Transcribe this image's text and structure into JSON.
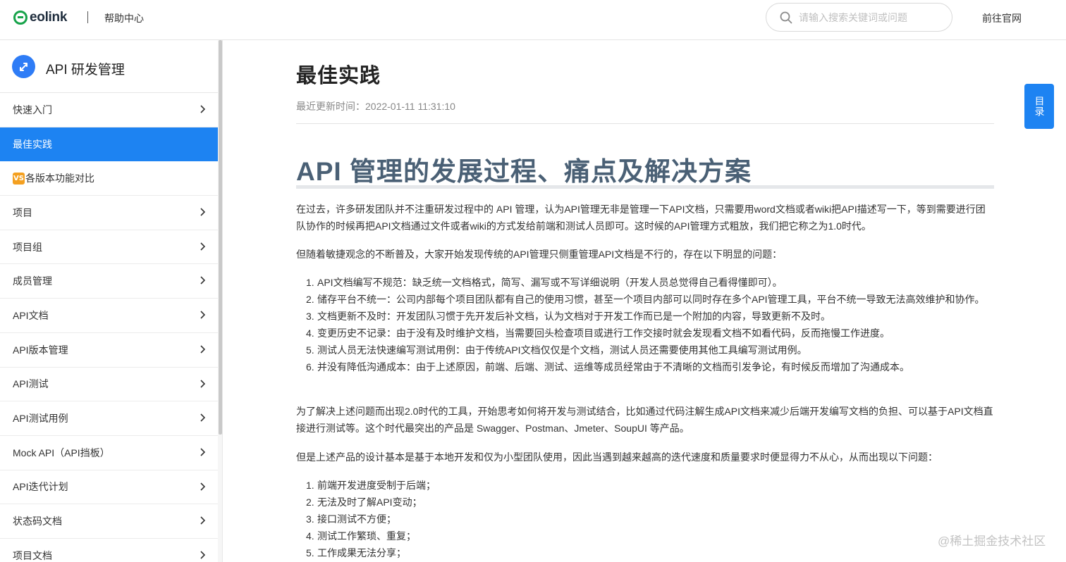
{
  "header": {
    "logo_text": "eolink",
    "help_center": "帮助中心",
    "search_placeholder": "请输入搜索关键词或问题",
    "official_site": "前往官网"
  },
  "sidebar": {
    "product_title": "API 研发管理",
    "items": [
      {
        "label": "快速入门",
        "chevron": true,
        "active": false
      },
      {
        "label": "最佳实践",
        "chevron": false,
        "active": true
      },
      {
        "label": "各版本功能对比",
        "chevron": false,
        "active": false,
        "badge": "VS"
      },
      {
        "label": "项目",
        "chevron": true,
        "active": false
      },
      {
        "label": "项目组",
        "chevron": true,
        "active": false
      },
      {
        "label": "成员管理",
        "chevron": true,
        "active": false
      },
      {
        "label": "API文档",
        "chevron": true,
        "active": false
      },
      {
        "label": "API版本管理",
        "chevron": true,
        "active": false
      },
      {
        "label": "API测试",
        "chevron": true,
        "active": false
      },
      {
        "label": "API测试用例",
        "chevron": true,
        "active": false
      },
      {
        "label": "Mock API（API挡板）",
        "chevron": true,
        "active": false
      },
      {
        "label": "API迭代计划",
        "chevron": true,
        "active": false
      },
      {
        "label": "状态码文档",
        "chevron": true,
        "active": false
      },
      {
        "label": "项目文档",
        "chevron": true,
        "active": false
      }
    ]
  },
  "article": {
    "page_title": "最佳实践",
    "update_label": "最近更新时间：",
    "update_time": "2022-01-11 11:31:10",
    "heading": "API 管理的发展过程、痛点及解决方案",
    "p1": "在过去，许多研发团队并不注重研发过程中的 API 管理，认为API管理无非是管理一下API文档，只需要用word文档或者wiki把API描述写一下，等到需要进行团队协作的时候再把API文档通过文件或者wiki的方式发给前端和测试人员即可。这时候的API管理方式粗放，我们把它称之为1.0时代。",
    "p2": "但随着敏捷观念的不断普及，大家开始发现传统的API管理只侧重管理API文档是不行的，存在以下明显的问题：",
    "list1": [
      "API文档编写不规范：缺乏统一文档格式，简写、漏写或不写详细说明（开发人员总觉得自己看得懂即可）。",
      "储存平台不统一：公司内部每个项目团队都有自己的使用习惯，甚至一个项目内部可以同时存在多个API管理工具，平台不统一导致无法高效维护和协作。",
      "文档更新不及时：开发团队习惯于先开发后补文档，认为文档对于开发工作而已是一个附加的内容，导致更新不及时。",
      "变更历史不记录：由于没有及时维护文档，当需要回头检查项目或进行工作交接时就会发现看文档不如看代码，反而拖慢工作进度。",
      "测试人员无法快速编写测试用例：由于传统API文档仅仅是个文档，测试人员还需要使用其他工具编写测试用例。",
      "并没有降低沟通成本：由于上述原因，前端、后端、测试、运维等成员经常由于不清晰的文档而引发争论，有时候反而增加了沟通成本。"
    ],
    "p3": "为了解决上述问题而出现2.0时代的工具，开始思考如何将开发与测试结合，比如通过代码注解生成API文档来减少后端开发编写文档的负担、可以基于API文档直接进行测试等。这个时代最突出的产品是 Swagger、Postman、Jmeter、SoupUI 等产品。",
    "p4": "但是上述产品的设计基本是基于本地开发和仅为小型团队使用，因此当遇到越来越高的迭代速度和质量要求时便显得力不从心，从而出现以下问题：",
    "list2": [
      "前端开发进度受制于后端；",
      "无法及时了解API变动；",
      "接口测试不方便；",
      "测试工作繁琐、重复；",
      "工作成果无法分享；"
    ]
  },
  "toc_button": "目录",
  "watermark": "@稀土掘金技术社区",
  "colors": {
    "accent": "#1d83f2",
    "brand_green": "#17a34a",
    "heading": "#4a6075",
    "badge": "#f4a020"
  }
}
